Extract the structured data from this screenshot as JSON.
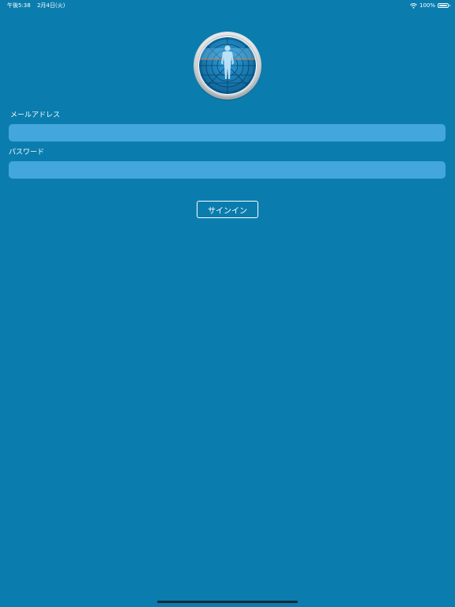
{
  "status_bar": {
    "time": "午後5:38",
    "date": "2月4日(火)",
    "battery": "100%",
    "icons": [
      "wifi-icon",
      "battery-icon"
    ]
  },
  "logo": {
    "icon": "body-scan-logo-icon"
  },
  "form": {
    "email_label": "メールアドレス",
    "email_value": "",
    "password_label": "パスワード",
    "password_value": ""
  },
  "signin_button": {
    "label": "サインイン"
  },
  "colors": {
    "background": "#0a7dae",
    "input_fill": "#43a6dc",
    "text": "#ffffff"
  }
}
